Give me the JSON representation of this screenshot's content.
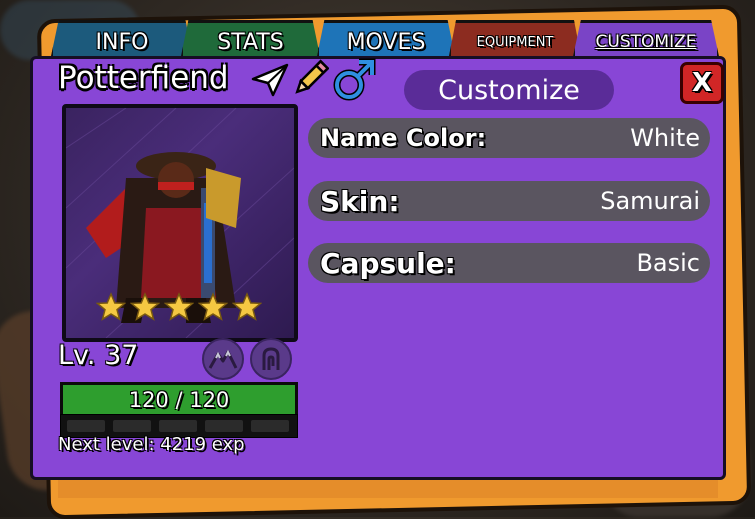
{
  "tabs": [
    {
      "label": "INFO"
    },
    {
      "label": "STATS"
    },
    {
      "label": "MOVES"
    },
    {
      "label": "EQUIPMENT"
    },
    {
      "label": "CUSTOMIZE"
    }
  ],
  "active_tab": "CUSTOMIZE",
  "character": {
    "name": "Potterfiend",
    "level_text": "Lv. 37",
    "stars": 5,
    "hp_text": "120 / 120",
    "hp_fraction": 1.0,
    "next_level_text": "Next level: 4219 exp",
    "gender": "male",
    "icons": [
      "paper-plane-icon",
      "pencil-icon",
      "male-symbol-icon",
      "mountain-icon",
      "sigil-icon"
    ]
  },
  "customize": {
    "title": "Customize",
    "close_label": "X",
    "rows": [
      {
        "label": "Name Color:",
        "value": "White"
      },
      {
        "label": "Skin:",
        "value": "Samurai"
      },
      {
        "label": "Capsule:",
        "value": "Basic"
      }
    ]
  },
  "colors": {
    "panel": "#8846d6",
    "accent_orange": "#f09a2e",
    "hp_green": "#2e9e2e",
    "close_red": "#d12626",
    "star_gold": "#f5c842"
  }
}
